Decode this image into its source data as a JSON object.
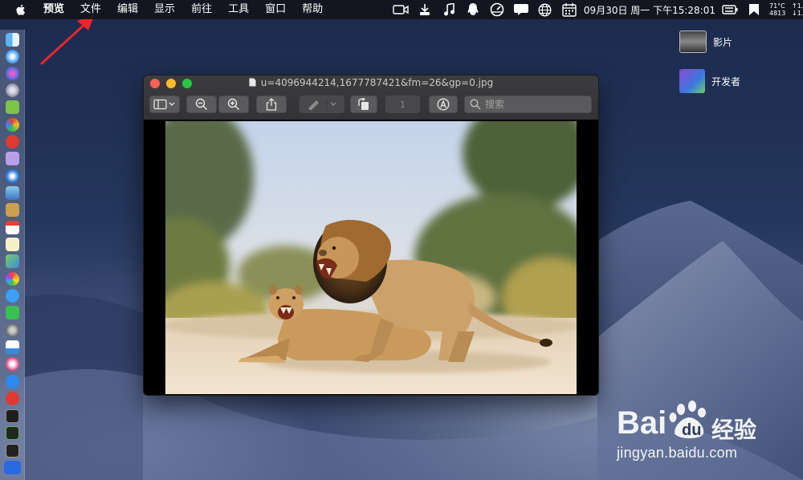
{
  "menubar": {
    "app_name": "预览",
    "items": [
      "文件",
      "编辑",
      "显示",
      "前往",
      "工具",
      "窗口",
      "帮助"
    ],
    "datetime": "09月30日 周一 下午15:28:01",
    "temp_line1": "71°C",
    "temp_line2": "4813",
    "net_line1": "↑1.0",
    "net_line2": "↓1.0"
  },
  "desktop_items": [
    {
      "label": "影片"
    },
    {
      "label": "开发者"
    }
  ],
  "window": {
    "title": "u=4096944214,1677787421&fm=26&gp=0.jpg",
    "page_field": "1",
    "search_placeholder": "搜索"
  },
  "watermark": {
    "text": "经验",
    "url": "jingyan.baidu.com"
  },
  "colors": {
    "close": "#fe5f57",
    "minimize": "#febc2e",
    "maximize": "#28c840",
    "annotation_arrow": "#e8262b"
  }
}
